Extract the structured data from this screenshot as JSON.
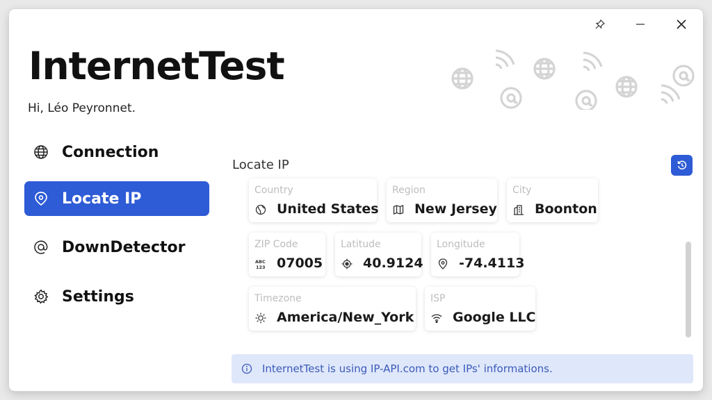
{
  "window": {
    "pin_icon": "pin-icon",
    "minimize_icon": "minimize-icon",
    "close_icon": "close-icon"
  },
  "app": {
    "title": "InternetTest",
    "greeting": "Hi, Léo Peyronnet."
  },
  "sidebar": {
    "items": [
      {
        "label": "Connection",
        "icon": "globe-icon",
        "active": false
      },
      {
        "label": "Locate IP",
        "icon": "location-pin-icon",
        "active": true
      },
      {
        "label": "DownDetector",
        "icon": "at-icon",
        "active": false
      },
      {
        "label": "Settings",
        "icon": "gear-icon",
        "active": false
      }
    ]
  },
  "main": {
    "title": "Locate IP",
    "refresh_icon": "refresh-icon",
    "cards": [
      {
        "label": "Country",
        "value": "United States",
        "icon": "globe-icon"
      },
      {
        "label": "Region",
        "value": "New Jersey",
        "icon": "map-icon"
      },
      {
        "label": "City",
        "value": "Boonton",
        "icon": "building-icon"
      },
      {
        "label": "ZIP Code",
        "value": "07005",
        "icon": "abc-123-icon"
      },
      {
        "label": "Latitude",
        "value": "40.9124",
        "icon": "crosshair-icon"
      },
      {
        "label": "Longitude",
        "value": "-74.4113",
        "icon": "location-pin-icon"
      },
      {
        "label": "Timezone",
        "value": "America/New_York",
        "icon": "sun-icon"
      },
      {
        "label": "ISP",
        "value": "Google LLC",
        "icon": "wifi-icon"
      }
    ]
  },
  "infobar": {
    "text": "InternetTest is using IP-API.com to get IPs' informations.",
    "icon": "info-icon"
  },
  "colors": {
    "accent": "#2e5bd6",
    "info_bg": "#dfe7fb",
    "info_text": "#3a5bb8"
  }
}
